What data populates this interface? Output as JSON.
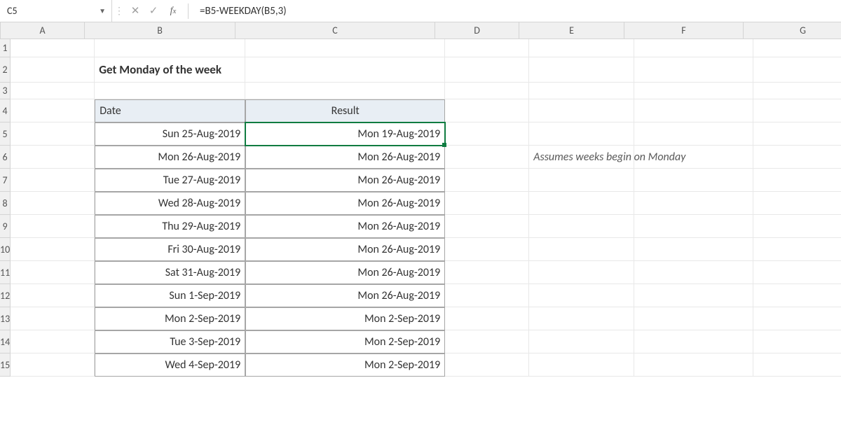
{
  "nameBox": "C5",
  "formula": "=B5-WEEKDAY(B5,3)",
  "columns": [
    "A",
    "B",
    "C",
    "D",
    "E",
    "F",
    "G"
  ],
  "rowNumbers": [
    "1",
    "2",
    "3",
    "4",
    "5",
    "6",
    "7",
    "8",
    "9",
    "10",
    "11",
    "12",
    "13",
    "14",
    "15"
  ],
  "title": "Get Monday of the week",
  "headers": {
    "date": "Date",
    "result": "Result"
  },
  "tableRows": [
    {
      "date": "Sun 25-Aug-2019",
      "result": "Mon 19-Aug-2019"
    },
    {
      "date": "Mon 26-Aug-2019",
      "result": "Mon 26-Aug-2019"
    },
    {
      "date": "Tue 27-Aug-2019",
      "result": "Mon 26-Aug-2019"
    },
    {
      "date": "Wed 28-Aug-2019",
      "result": "Mon 26-Aug-2019"
    },
    {
      "date": "Thu 29-Aug-2019",
      "result": "Mon 26-Aug-2019"
    },
    {
      "date": "Fri 30-Aug-2019",
      "result": "Mon 26-Aug-2019"
    },
    {
      "date": "Sat 31-Aug-2019",
      "result": "Mon 26-Aug-2019"
    },
    {
      "date": "Sun 1-Sep-2019",
      "result": "Mon 26-Aug-2019"
    },
    {
      "date": "Mon 2-Sep-2019",
      "result": "Mon 2-Sep-2019"
    },
    {
      "date": "Tue 3-Sep-2019",
      "result": "Mon 2-Sep-2019"
    },
    {
      "date": "Wed 4-Sep-2019",
      "result": "Mon 2-Sep-2019"
    }
  ],
  "annotation": "Assumes weeks begin on Monday",
  "rowHeights": {
    "default": 33,
    "header": 24
  },
  "colWidths": {
    "A": 120,
    "B": 215,
    "C": 285,
    "D": 120,
    "E": 150,
    "F": 170,
    "G": 170
  }
}
